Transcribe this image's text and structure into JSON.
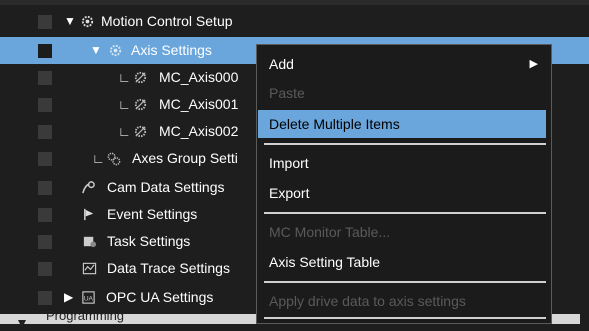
{
  "tree": {
    "items": [
      {
        "label": "Motion Control Setup",
        "icon": "gear-icon",
        "expanded": true
      },
      {
        "label": "Axis Settings",
        "icon": "gear-icon",
        "expanded": true,
        "selected": true
      },
      {
        "label": "MC_Axis000",
        "icon": "axis-icon"
      },
      {
        "label": "MC_Axis001",
        "icon": "axis-icon"
      },
      {
        "label": "MC_Axis002",
        "icon": "axis-icon"
      },
      {
        "label": "Axes Group Setti",
        "icon": "axes-group-icon"
      },
      {
        "label": "Cam Data Settings",
        "icon": "cam-icon"
      },
      {
        "label": "Event Settings",
        "icon": "flag-icon"
      },
      {
        "label": "Task Settings",
        "icon": "task-icon"
      },
      {
        "label": "Data Trace Settings",
        "icon": "trace-icon"
      },
      {
        "label": "OPC UA Settings",
        "icon": "opcua-icon",
        "expanded": false
      }
    ],
    "bottom_label": "Programming"
  },
  "context_menu": {
    "items": {
      "add": "Add",
      "paste": "Paste",
      "delete_multiple": "Delete Multiple Items",
      "import": "Import",
      "export": "Export",
      "mc_monitor": "MC Monitor Table...",
      "axis_setting_table": "Axis Setting Table",
      "apply_drive": "Apply drive data to axis settings"
    },
    "disabled": [
      "Paste",
      "MC Monitor Table...",
      "Apply drive data to axis settings"
    ],
    "highlighted": "Delete Multiple Items"
  },
  "colors": {
    "background": "#1e1e1e",
    "selection": "#6aa6dc",
    "menu_background": "#1b1b1b",
    "disabled_text": "#5a5a5a"
  }
}
